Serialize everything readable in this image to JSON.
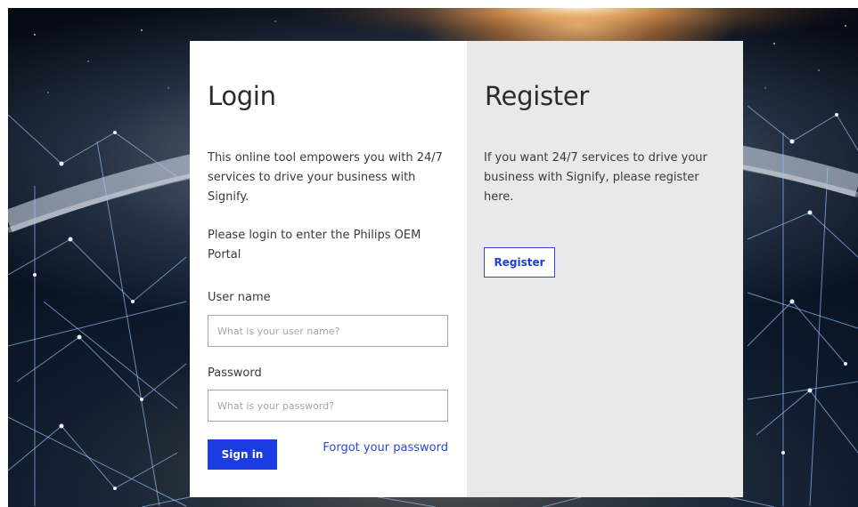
{
  "login": {
    "title": "Login",
    "intro": "This online tool empowers you with 24/7 services to drive your business with Signify.",
    "instruction": "Please login to enter the Philips OEM Portal",
    "username_label": "User name",
    "username_placeholder": "What is your user name?",
    "password_label": "Password",
    "password_placeholder": "What is your password?",
    "signin_label": "Sign in",
    "forgot_label": "Forgot your password"
  },
  "register": {
    "title": "Register",
    "text": "If you want 24/7 services to drive your business with Signify, please register here.",
    "button_label": "Register"
  },
  "colors": {
    "primary": "#1b3ce0",
    "link": "#2c49d6",
    "register_panel": "#e9e9ea"
  },
  "background": {
    "description_icon": "earth-network-background"
  }
}
